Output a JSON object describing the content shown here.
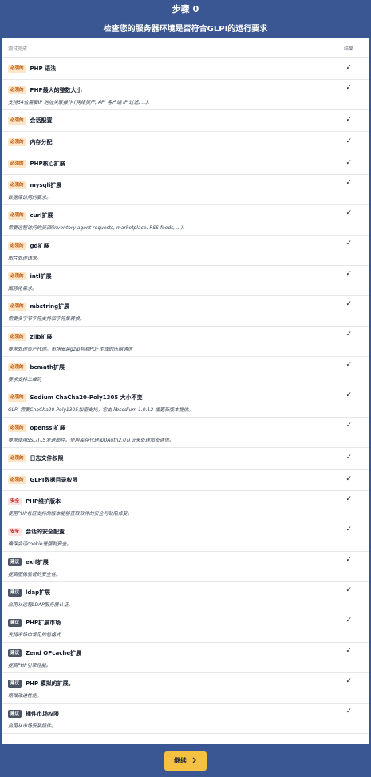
{
  "header": {
    "step": "步骤 0",
    "subtitle": "检查您的服务器环境是否符合GLPI的运行要求"
  },
  "table": {
    "col_test": "测试完成",
    "col_result": "结果"
  },
  "badges": {
    "required": "必须的",
    "security": "安全",
    "suggested": "建议"
  },
  "rows": [
    {
      "type": "required",
      "name": "PHP 语法",
      "desc": "",
      "result": "✓"
    },
    {
      "type": "required",
      "name": "PHP最大的整数大小",
      "desc": "支持64位需要IP 地址关联操作 (网络资产, API 客户端 IP 过滤, ...).",
      "result": "✓"
    },
    {
      "type": "required",
      "name": "会话配置",
      "desc": "",
      "result": "✓"
    },
    {
      "type": "required",
      "name": "内存分配",
      "desc": "",
      "result": "✓"
    },
    {
      "type": "required",
      "name": "PHP核心扩展",
      "desc": "",
      "result": "✓"
    },
    {
      "type": "required",
      "name": "mysqli扩展",
      "desc": "数据库访问的要求。",
      "result": "✓"
    },
    {
      "type": "required",
      "name": "curl扩展",
      "desc": "需要远程访问的资源(inventory agent requests, marketplace, RSS feeds, ...).",
      "result": "✓"
    },
    {
      "type": "required",
      "name": "gd扩展",
      "desc": "图片处理请求。",
      "result": "✓"
    },
    {
      "type": "required",
      "name": "intl扩展",
      "desc": "国际化需求。",
      "result": "✓"
    },
    {
      "type": "required",
      "name": "mbstring扩展",
      "desc": "需要多字节字符支持和字符集转换。",
      "result": "✓"
    },
    {
      "type": "required",
      "name": "zlib扩展",
      "desc": "要求处理资产代理。市场安装gzip包和PDF生成的压缩通信",
      "result": "✓"
    },
    {
      "type": "required",
      "name": "bcmath扩展",
      "desc": "要求支持二维码",
      "result": "✓"
    },
    {
      "type": "required",
      "name": "Sodium ChaCha20-Poly1305 大小不变",
      "desc": "GLPI 需要ChaCha20-Poly1305加密支持。它由 libsodium 1.0.12 或更新版本提供。",
      "result": "✓"
    },
    {
      "type": "required",
      "name": "openssl扩展",
      "desc": "要求使用SSL/TLS发送邮件。使用库存代理和OAuth2.0认证来处理加密通信。",
      "result": "✓"
    },
    {
      "type": "required",
      "name": "日志文件权限",
      "desc": "",
      "result": "✓"
    },
    {
      "type": "required",
      "name": "GLPI数据目录权限",
      "desc": "",
      "result": "✓"
    },
    {
      "type": "security",
      "name": "PHP维护版本",
      "desc": "使用PHP社区支持的版本能够获取软件的安全与缺陷修复。",
      "result": "✓"
    },
    {
      "type": "security",
      "name": "会话的安全配置",
      "desc": "确保会话cookie是强制安全。",
      "result": "✓"
    },
    {
      "type": "suggested",
      "name": "exif扩展",
      "desc": "提高图像验证的安全性。",
      "result": "✓"
    },
    {
      "type": "suggested",
      "name": "ldap扩展",
      "desc": "启用从远程LDAP服务器认证。",
      "result": "✓"
    },
    {
      "type": "suggested",
      "name": "PHP扩展市场",
      "desc": "支持市场中常见的包格式",
      "result": "✓"
    },
    {
      "type": "suggested",
      "name": "Zend OPcache扩展",
      "desc": "提高PHP引擎性能。",
      "result": "✓"
    },
    {
      "type": "suggested",
      "name": "PHP 模拟的扩展。",
      "desc": "略微改进性能。",
      "result": "✓"
    },
    {
      "type": "suggested",
      "name": "插件市场权限",
      "desc": "启用从市场安装插件。",
      "result": "✓"
    }
  ],
  "footer": {
    "continue_label": "继续",
    "continue_icon": "chevron-right-icon"
  }
}
